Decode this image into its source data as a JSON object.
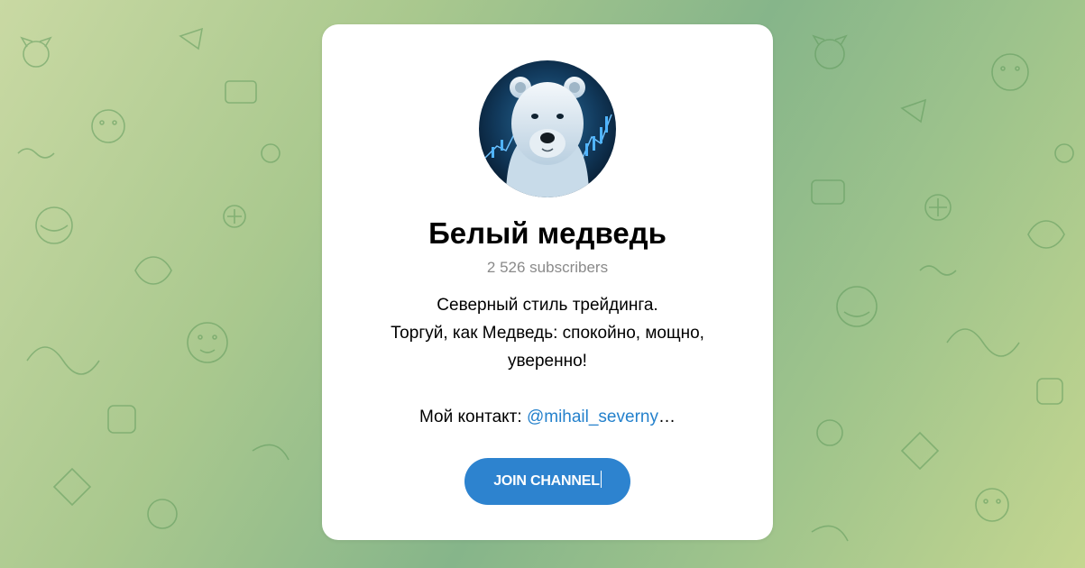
{
  "channel": {
    "title": "Белый медведь",
    "subscribers": "2 526 subscribers",
    "description_lines": [
      "Северный стиль трейдинга.",
      "Торгуй, как Медведь: спокойно, мощно,",
      "уверенно!"
    ],
    "contact_label": "Мой контакт: ",
    "contact_link": "@mihail_severny",
    "contact_ellipsis": "…",
    "avatar_icon": "polar-bear-avatar"
  },
  "join_button": {
    "label": "JOIN CHANNEL"
  },
  "colors": {
    "accent": "#2d83cf",
    "link": "#2481cc",
    "muted": "#8a8a8a",
    "background_green": "#9fc48c"
  }
}
